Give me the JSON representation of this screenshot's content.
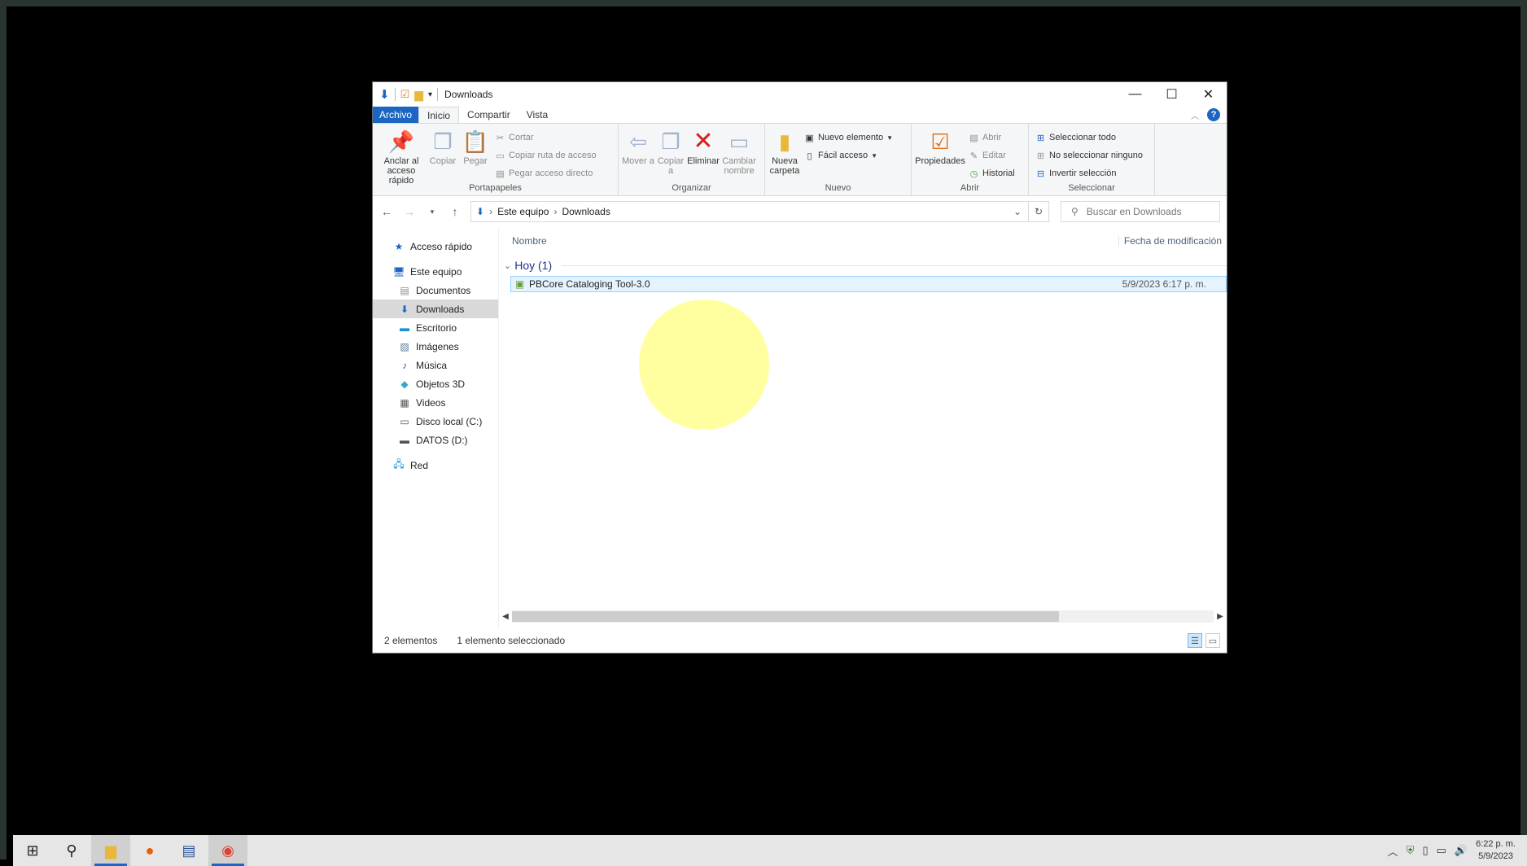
{
  "window": {
    "title": "Downloads",
    "controls": {
      "minimize": "—",
      "maximize": "☐",
      "close": "✕"
    }
  },
  "ribbon_tabs": [
    "Archivo",
    "Inicio",
    "Compartir",
    "Vista"
  ],
  "ribbon": {
    "portapapeles": {
      "label": "Portapapeles",
      "pin": "Anclar al acceso rápido",
      "copy": "Copiar",
      "paste": "Pegar",
      "cut": "Cortar",
      "copy_path": "Copiar ruta de acceso",
      "paste_shortcut": "Pegar acceso directo"
    },
    "organizar": {
      "label": "Organizar",
      "move": "Mover a",
      "copy_to": "Copiar a",
      "delete": "Eliminar",
      "rename": "Cambiar nombre"
    },
    "nuevo": {
      "label": "Nuevo",
      "new_folder": "Nueva carpeta",
      "new_item": "Nuevo elemento",
      "easy_access": "Fácil acceso"
    },
    "abrir": {
      "label": "Abrir",
      "properties": "Propiedades",
      "open": "Abrir",
      "edit": "Editar",
      "history": "Historial"
    },
    "seleccionar": {
      "label": "Seleccionar",
      "select_all": "Seleccionar todo",
      "select_none": "No seleccionar ninguno",
      "invert": "Invertir selección"
    }
  },
  "address": {
    "crumbs": [
      "Este equipo",
      "Downloads"
    ],
    "search_placeholder": "Buscar en Downloads"
  },
  "sidebar": [
    {
      "label": "Acceso rápido",
      "icon": "star-icon"
    },
    {
      "label": "Este equipo",
      "icon": "pc-icon"
    },
    {
      "label": "Documentos",
      "icon": "document-icon"
    },
    {
      "label": "Downloads",
      "icon": "download-icon",
      "selected": true
    },
    {
      "label": "Escritorio",
      "icon": "desktop-icon"
    },
    {
      "label": "Imágenes",
      "icon": "images-icon"
    },
    {
      "label": "Música",
      "icon": "music-icon"
    },
    {
      "label": "Objetos 3D",
      "icon": "cube-icon"
    },
    {
      "label": "Videos",
      "icon": "video-icon"
    },
    {
      "label": "Disco local (C:)",
      "icon": "drive-icon"
    },
    {
      "label": "DATOS (D:)",
      "icon": "drive-icon"
    },
    {
      "label": "Red",
      "icon": "network-icon"
    }
  ],
  "columns": {
    "name": "Nombre",
    "date": "Fecha de modificación"
  },
  "group": {
    "label": "Hoy (1)"
  },
  "files": [
    {
      "name": "PBCore Cataloging Tool-3.0",
      "date": "5/9/2023 6:17 p. m.",
      "icon": "archive-icon"
    }
  ],
  "status": {
    "count": "2 elementos",
    "selection": "1 elemento seleccionado"
  },
  "taskbar": {
    "apps": [
      "start-icon",
      "search-icon",
      "file-explorer-icon",
      "firefox-icon",
      "word-icon",
      "chrome-icon"
    ],
    "time": "6:22 p. m.",
    "date": "5/9/2023"
  },
  "colors": {
    "accent": "#1a66c2",
    "selection": "#e5f3ff",
    "highlight": "#ffff50"
  }
}
